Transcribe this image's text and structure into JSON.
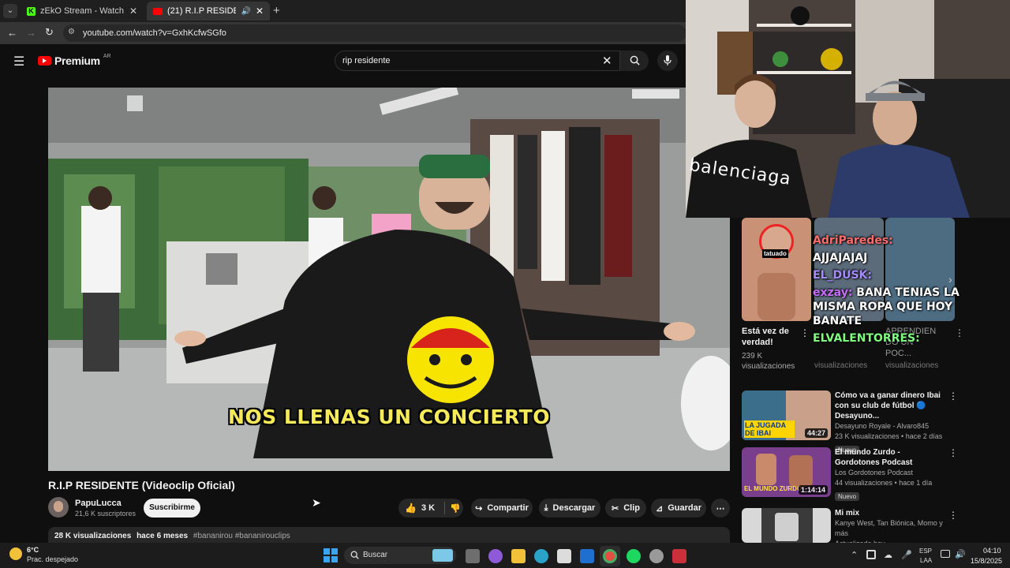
{
  "browser": {
    "tabs": [
      {
        "title": "zEkO Stream - Watch Live on K",
        "active": false
      },
      {
        "title": "(21) R.I.P RESIDENTE (Videoc",
        "active": true
      }
    ],
    "url": "youtube.com/watch?v=GxhKcfwSGfo"
  },
  "youtube": {
    "logo_text": "Premium",
    "region": "AR",
    "search_value": "rip residente"
  },
  "video": {
    "subtitle": "NOS LLENAS UN CONCIERTO",
    "title": "R.I.P RESIDENTE (Videoclip Oficial)",
    "channel": "PapuLucca",
    "subscribers": "21,6 K suscriptores",
    "subscribe_label": "Suscribirme",
    "likes": "3 K",
    "share_label": "Compartir",
    "download_label": "Descargar",
    "clip_label": "Clip",
    "save_label": "Guardar",
    "views": "28 K visualizaciones",
    "age": "hace 6 meses",
    "hashtags": "#bananirou #bananirouclips"
  },
  "camera": {
    "shirt_text": "balenciaga"
  },
  "shorts": [
    {
      "title": "Está vez de verdad!",
      "views": "239 K visualizaciones",
      "sticker": "tatuado"
    },
    {
      "title": "",
      "views": "visualizaciones"
    },
    {
      "title": "APRENDIEN DO UN POC...",
      "views": "visualizaciones"
    }
  ],
  "chat": [
    {
      "user": "",
      "text": "AJJAJAJAJ"
    },
    {
      "user": "EL_DUSK:",
      "text": ""
    },
    {
      "user": "exzay:",
      "text": "BANA TENIAS LA MISMA ROPA QUE HOY BANATE"
    },
    {
      "user": "ELVALENTORRES:",
      "text": ""
    },
    {
      "user": "",
      "text": "AdriParedes:"
    }
  ],
  "recommended": [
    {
      "title": "Cómo va a ganar dinero Ibai con su club de fútbol 🔵 Desayuno...",
      "channel": "Desayuno Royale - Alvaro845",
      "meta": "23 K visualizaciones • hace 2 días",
      "badge": "Nuevo",
      "duration": "44:27",
      "thumb_text": "LA JUGADA DE IBAI"
    },
    {
      "title": "El mundo Zurdo - Gordotones Podcast",
      "channel": "Los Gordotones Podcast",
      "meta": "44 visualizaciones • hace 1 día",
      "badge": "Nuevo",
      "duration": "1:14:14",
      "thumb_text": "EL MUNDO ZURDO"
    },
    {
      "title": "Mi mix",
      "channel": "Kanye West, Tan Biónica, Momo y más",
      "meta": "Actualizada hoy",
      "badge": "",
      "duration": "",
      "thumb_text": ""
    }
  ],
  "taskbar": {
    "weather_temp": "6°C",
    "weather_desc": "Prac. despejado",
    "search_label": "Buscar",
    "lang_top": "ESP",
    "lang_bottom": "LAA",
    "time": "04:10",
    "date": "15/8/2025"
  }
}
